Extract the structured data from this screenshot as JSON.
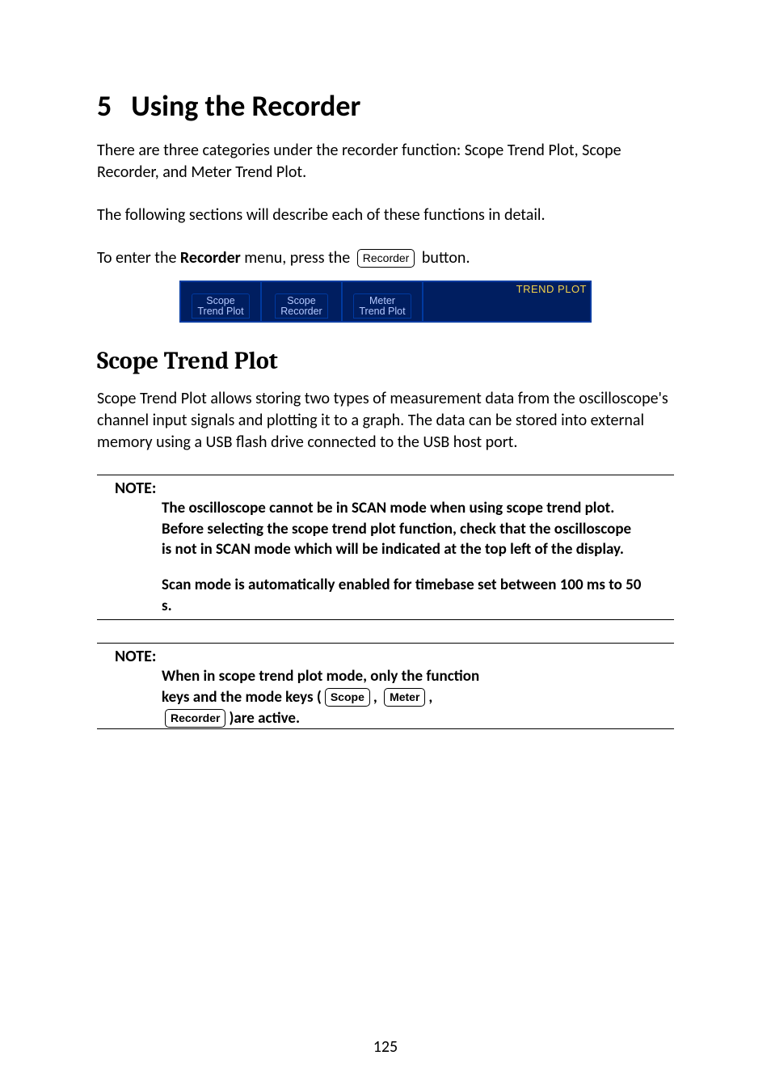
{
  "chapter": {
    "number": "5",
    "title": "Using the Recorder"
  },
  "p1": "There are three categories under the recorder function: Scope Trend Plot, Scope Recorder, and Meter Trend Plot.",
  "p2": "The following sections will describe each of these functions in detail.",
  "enter": {
    "pre": "To enter the ",
    "bold": "Recorder",
    "mid": " menu, press the ",
    "btn": "Recorder",
    "post": " button."
  },
  "menubar": {
    "tabs": [
      {
        "line1": "Scope",
        "line2": "Trend Plot"
      },
      {
        "line1": "Scope",
        "line2": "Recorder"
      },
      {
        "line1": "Meter",
        "line2": "Trend Plot"
      }
    ],
    "title": "TREND PLOT"
  },
  "section1": {
    "heading": "Scope Trend Plot",
    "body": "Scope Trend Plot allows storing two types of measurement data from the oscilloscope's channel input signals and plotting it to a graph.  The data can be stored into external memory using a USB flash drive connected to the USB host port."
  },
  "note1": {
    "label": "NOTE:",
    "p1": "The oscilloscope cannot be in SCAN mode when using scope trend plot. Before selecting the scope trend plot function, check that the oscilloscope is not in SCAN mode which will be indicated at the top left of the display.",
    "p2": "Scan mode is automatically enabled for timebase set between 100 ms to 50 s."
  },
  "note2": {
    "label": "NOTE:",
    "line1": "When in scope trend plot mode, only the function",
    "line2a": "keys and the mode keys (",
    "btn_scope": "Scope",
    "line2b": ", ",
    "btn_meter": "Meter",
    "line2c": ",",
    "btn_recorder": "Recorder",
    "line3": ")are active."
  },
  "pagenum": "125"
}
